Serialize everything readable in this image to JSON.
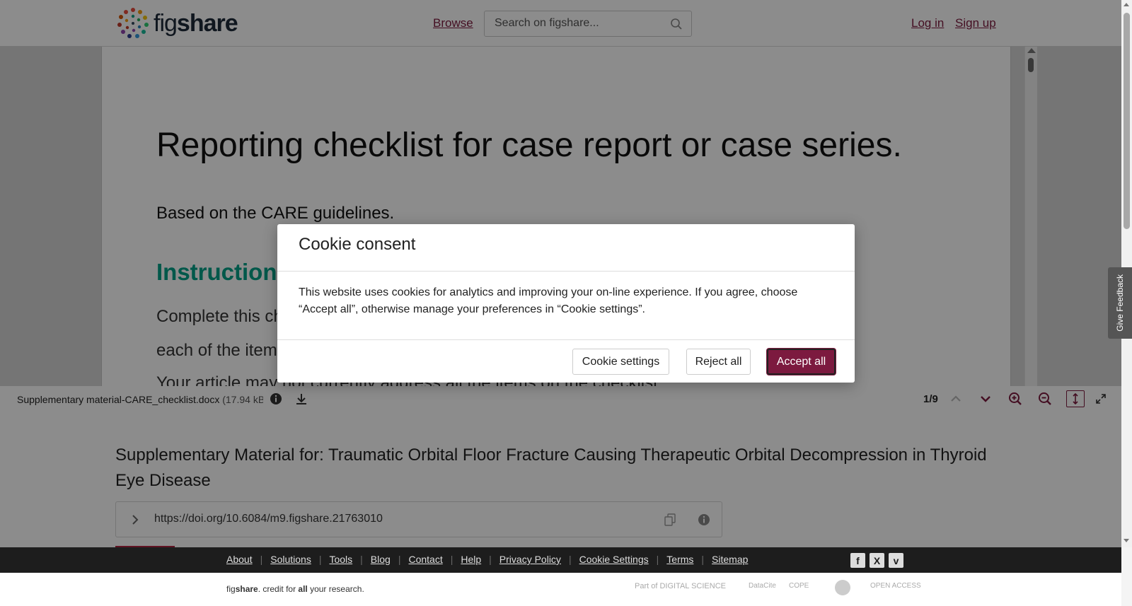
{
  "header": {
    "logo_text_fig": "fig",
    "logo_text_share": "share",
    "browse": "Browse",
    "search_placeholder": "Search on figshare...",
    "login": "Log in",
    "signup": "Sign up"
  },
  "document": {
    "title": "Reporting checklist for case report or case series.",
    "subtitle": "Based on the CARE guidelines.",
    "heading": "Instructions to authors",
    "body_line1": "Complete this checklist by entering the page numbers where reviewers will find",
    "body_line2": "each of the items listed below.",
    "body_line3": "Your article may not currently address all the items on the checklist."
  },
  "toolbar": {
    "file_name": "Supplementary material-CARE_checklist.docx",
    "file_size": "(17.94 kB)",
    "page_counter": "1/9"
  },
  "article": {
    "title": "Supplementary Material for: Traumatic Orbital Floor Fracture Causing Therapeutic Orbital Decompression in Thyroid Eye Disease",
    "doi": "https://doi.org/10.6084/m9.figshare.21763010"
  },
  "footer": {
    "links": [
      "About",
      "Solutions",
      "Tools",
      "Blog",
      "Contact",
      "Help",
      "Privacy Policy",
      "Cookie Settings",
      "Terms",
      "Sitemap"
    ],
    "credit_pre": "fig",
    "credit_bold": "share",
    "credit_mid": ". credit for ",
    "credit_all": "all",
    "credit_post": " your research.",
    "partners": [
      "Part of DIGITAL SCIENCE",
      "DataCite",
      "COPE",
      "",
      "OPEN ACCESS"
    ],
    "social": [
      "f",
      "X",
      "v"
    ]
  },
  "feedback": "Give Feedback",
  "modal": {
    "title": "Cookie consent",
    "text": "This website uses cookies for analytics and improving your on-line experience. If you agree, choose “Accept all”, otherwise manage your preferences in “Cookie settings”.",
    "settings_button": "Cookie settings",
    "reject_button": "Reject all",
    "accept_button": "Accept all"
  },
  "colors": {
    "brand": "#7c1a3f",
    "heading_green": "#00a087",
    "footer_dark": "#1d1d1d"
  }
}
